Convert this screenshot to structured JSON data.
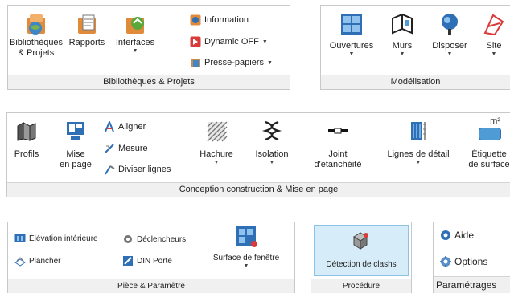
{
  "panel1": {
    "title": "Bibliothèques & Projets",
    "buttons": [
      {
        "line1": "Bibliothèques",
        "line2": "& Projets"
      },
      {
        "line1": "Rapports",
        "line2": ""
      },
      {
        "line1": "Interfaces",
        "line2": ""
      }
    ],
    "items": [
      {
        "label": "Information"
      },
      {
        "label": "Dynamic OFF"
      },
      {
        "label": "Presse-papiers"
      }
    ]
  },
  "panel2": {
    "title": "Modélisation",
    "buttons": [
      {
        "label": "Ouvertures"
      },
      {
        "label": "Murs"
      },
      {
        "label": "Disposer"
      },
      {
        "label": "Site"
      }
    ]
  },
  "panel3": {
    "title": "Conception construction & Mise en page",
    "buttons": [
      {
        "line1": "Profils",
        "line2": ""
      },
      {
        "line1": "Mise",
        "line2": "en page"
      },
      {
        "line1": "Hachure",
        "line2": ""
      },
      {
        "line1": "Isolation",
        "line2": ""
      },
      {
        "line1": "Joint",
        "line2": "d'étanchéité"
      },
      {
        "line1": "Lignes de détail",
        "line2": ""
      },
      {
        "line1": "Étiquette",
        "line2": "de surface"
      }
    ],
    "items": [
      {
        "label": "Aligner"
      },
      {
        "label": "Mesure"
      },
      {
        "label": "Diviser lignes"
      }
    ],
    "m2_text": "m²"
  },
  "panel4": {
    "title": "Pièce & Paramètre",
    "items": [
      {
        "label": "Élévation intérieure"
      },
      {
        "label": "Déclencheurs"
      },
      {
        "label": "Plancher"
      },
      {
        "label": "DIN Porte"
      }
    ],
    "big_button": {
      "label": "Surface de fenêtre"
    }
  },
  "panel5": {
    "title": "Procédure",
    "button": {
      "label": "Détection de clashs"
    }
  },
  "panel6": {
    "title": "Paramétrages",
    "items": [
      {
        "label": "Aide"
      },
      {
        "label": "Options"
      }
    ]
  },
  "colors": {
    "accent_blue": "#2e6fb6",
    "orange": "#e07a2a",
    "red": "#d93a3a",
    "panel_title_bg": "#f0f0f0",
    "selected_bg": "#d6ecf8"
  }
}
